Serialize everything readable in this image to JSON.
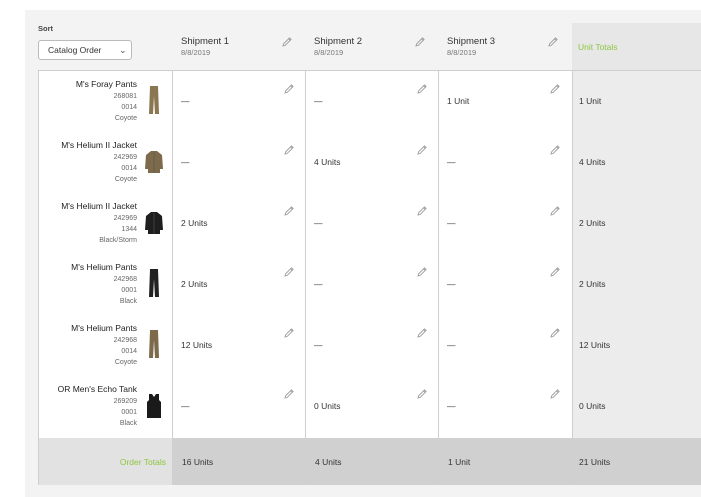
{
  "sort": {
    "label": "Sort",
    "selected": "Catalog Order"
  },
  "shipments": [
    {
      "title": "Shipment 1",
      "date": "8/8/2019"
    },
    {
      "title": "Shipment 2",
      "date": "8/8/2019"
    },
    {
      "title": "Shipment 3",
      "date": "8/8/2019"
    }
  ],
  "unit_totals_label": "Unit Totals",
  "rows": [
    {
      "name": "M's Foray Pants",
      "sku": "268081",
      "code": "0014",
      "color": "Coyote",
      "cells": [
        "—",
        "—",
        "1 Unit"
      ],
      "total": "1 Unit",
      "thumb": "pants",
      "thumb_color": "#8a7650"
    },
    {
      "name": "M's Helium II Jacket",
      "sku": "242969",
      "code": "0014",
      "color": "Coyote",
      "cells": [
        "—",
        "4 Units",
        "—"
      ],
      "total": "4 Units",
      "thumb": "jacket",
      "thumb_color": "#7d6a4a"
    },
    {
      "name": "M's Helium II Jacket",
      "sku": "242969",
      "code": "1344",
      "color": "Black/Storm",
      "cells": [
        "2 Units",
        "—",
        "—"
      ],
      "total": "2 Units",
      "thumb": "jacket",
      "thumb_color": "#1e1e1e"
    },
    {
      "name": "M's Helium Pants",
      "sku": "242968",
      "code": "0001",
      "color": "Black",
      "cells": [
        "2 Units",
        "—",
        "—"
      ],
      "total": "2 Units",
      "thumb": "pants",
      "thumb_color": "#222222"
    },
    {
      "name": "M's Helium Pants",
      "sku": "242968",
      "code": "0014",
      "color": "Coyote",
      "cells": [
        "12 Units",
        "—",
        "—"
      ],
      "total": "12 Units",
      "thumb": "pants",
      "thumb_color": "#7d6a4a"
    },
    {
      "name": "OR Men's Echo Tank",
      "sku": "269209",
      "code": "0001",
      "color": "Black",
      "cells": [
        "—",
        "0 Units",
        "—"
      ],
      "total": "0 Units",
      "thumb": "tank",
      "thumb_color": "#1a1a1a"
    }
  ],
  "footer": {
    "label": "Order Totals",
    "values": [
      "16 Units",
      "4 Units",
      "1 Unit"
    ],
    "total": "21 Units"
  },
  "colors": {
    "accent": "#8dc63f"
  }
}
